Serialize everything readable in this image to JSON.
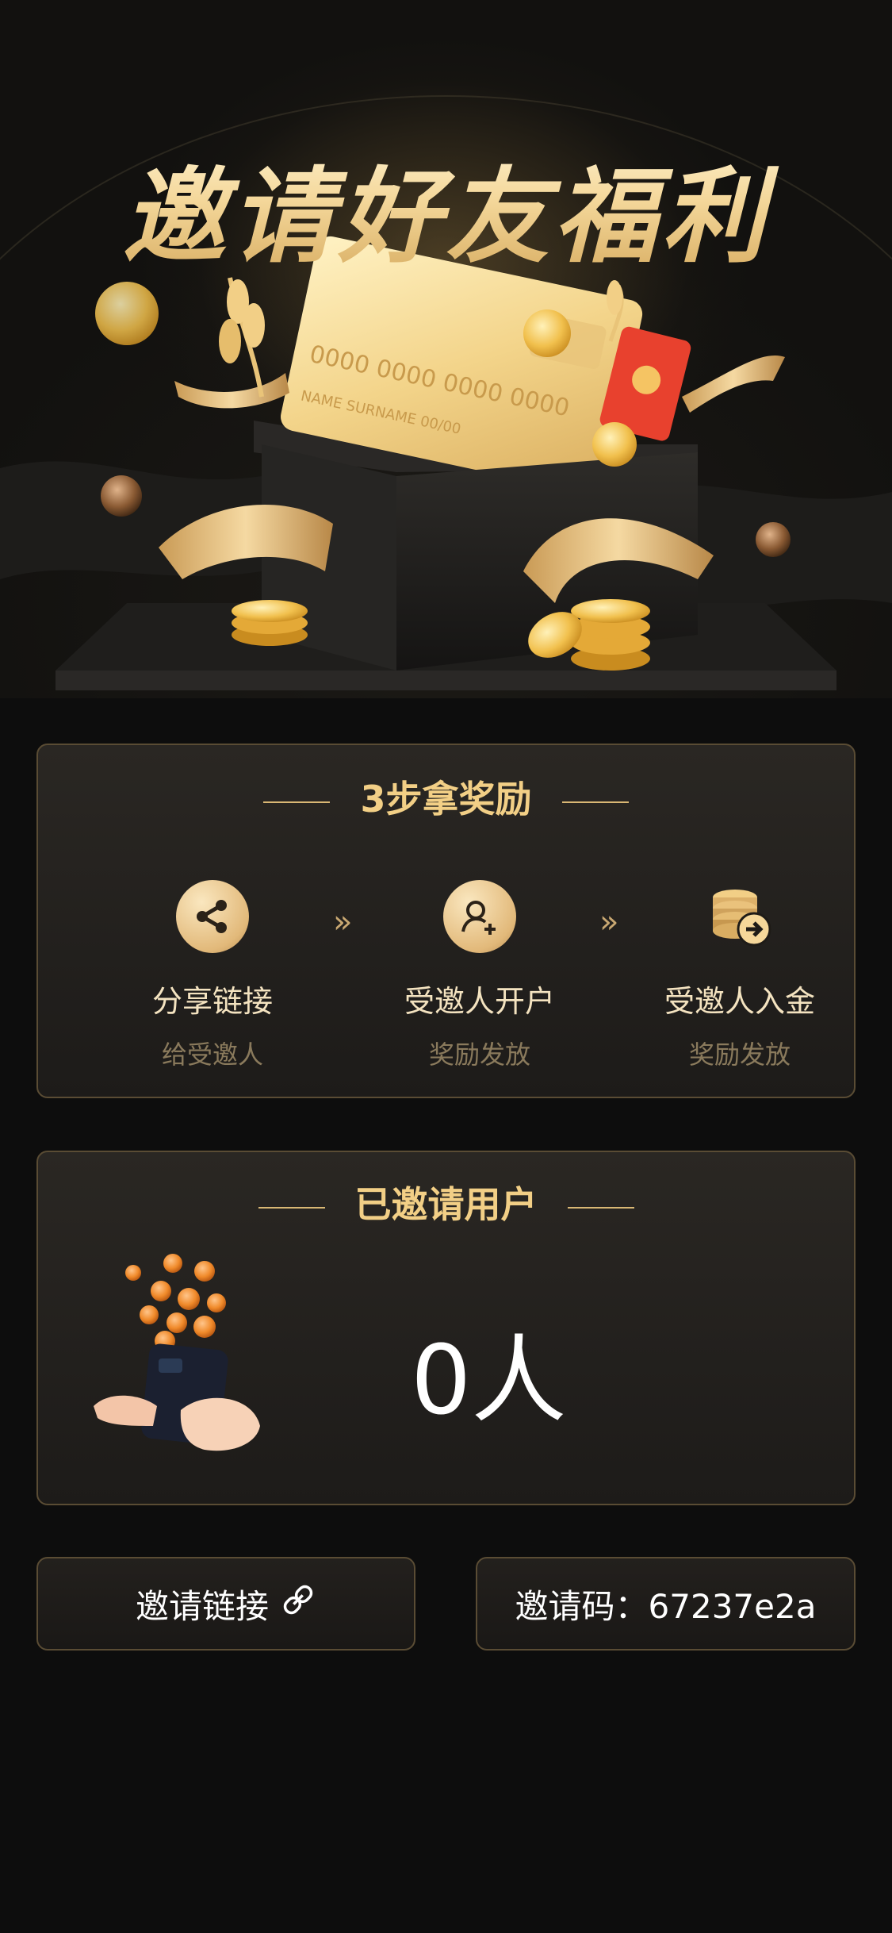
{
  "hero": {
    "title": "邀请好友福利",
    "card_number": "0000  0000  0000  0000",
    "card_name": "NAME SURNAME  00/00"
  },
  "steps_card": {
    "title": "3步拿奖励",
    "steps": [
      {
        "label": "分享链接",
        "sub": "给受邀人",
        "icon": "share-icon"
      },
      {
        "label": "受邀人开户",
        "sub": "奖励发放",
        "icon": "add-user-icon"
      },
      {
        "label": "受邀人入金",
        "sub": "奖励发放",
        "icon": "coins-deposit-icon"
      }
    ]
  },
  "invited_card": {
    "title": "已邀请用户",
    "count": "0人"
  },
  "actions": {
    "link_label": "邀请链接",
    "code_label": "邀请码：67237e2a"
  },
  "colors": {
    "accent_gold": "#f2cf86",
    "border_gold": "#5a4c34",
    "background": "#0d0d0d"
  }
}
